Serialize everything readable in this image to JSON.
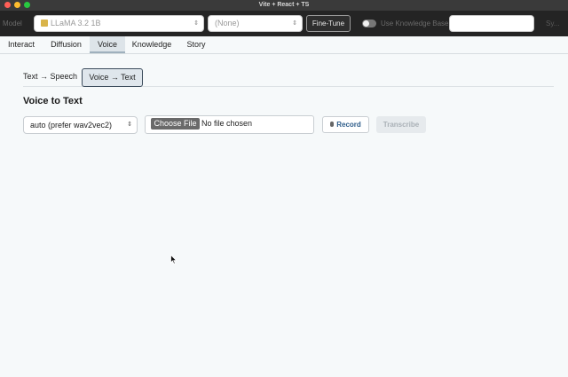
{
  "window": {
    "title": "Vite + React + TS"
  },
  "toolbar": {
    "model_label": "Model",
    "model_value": "LLaMA 3.2 1B",
    "adapter_value": "(None)",
    "finetune_label": "Fine-Tune",
    "knowledge_toggle_label": "Use Knowledge Base",
    "knowledge_toggle_on": false,
    "knowledge_select_value": "",
    "trailing_label": "Sy..."
  },
  "tabs": {
    "items": [
      {
        "label": "Interact"
      },
      {
        "label": "Diffusion"
      },
      {
        "label": "Voice"
      },
      {
        "label": "Knowledge"
      },
      {
        "label": "Story"
      }
    ],
    "active": "Voice"
  },
  "voice": {
    "subtabs": [
      {
        "label": "Text → Speech"
      },
      {
        "label": "Voice → Text"
      }
    ],
    "active_subtab": "Voice → Text",
    "section_title": "Voice to Text",
    "engine_select_value": "auto (prefer wav2vec2)",
    "file_button_label": "Choose File",
    "file_status": "No file chosen",
    "record_label": "Record",
    "transcribe_label": "Transcribe"
  },
  "colors": {
    "titlebar": "#3a3a3a",
    "toolbar": "#242424",
    "page_background": "#f6f9fa",
    "active_tab": "#dde4e9",
    "record_text": "#2e5d8a",
    "disabled_button": "#e6eaed"
  },
  "icons": [
    "model-badge-icon",
    "chevron-updown-icon",
    "microphone-icon",
    "mouse-cursor-icon"
  ]
}
